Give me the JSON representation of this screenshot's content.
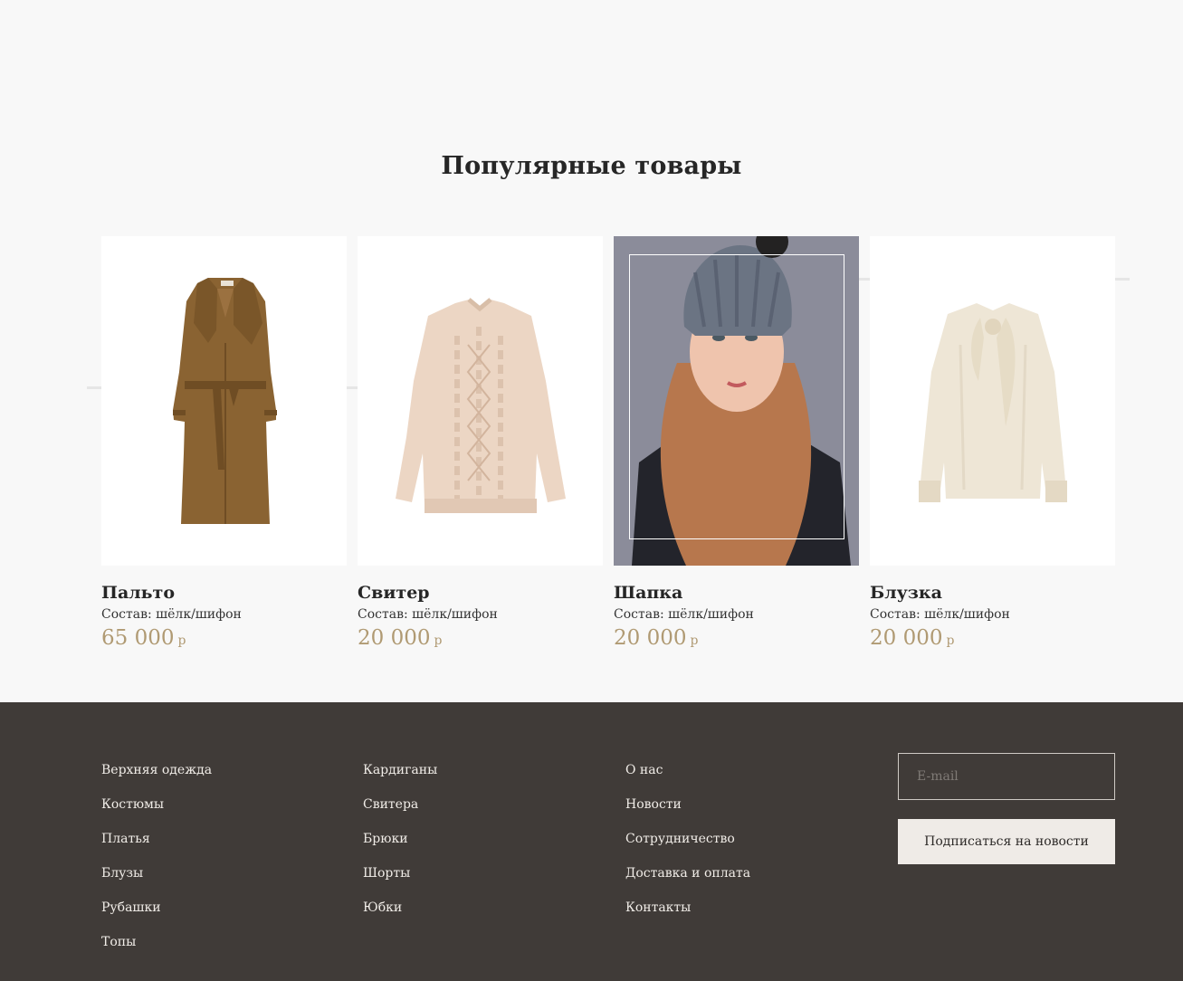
{
  "section": {
    "title": "Популярные товары"
  },
  "products": [
    {
      "name": "Пальто",
      "composition": "Состав: шёлк/шифон",
      "price": "65 000",
      "currency": "р",
      "image": "coat-image"
    },
    {
      "name": "Свитер",
      "composition": "Состав: шёлк/шифон",
      "price": "20 000",
      "currency": "р",
      "image": "sweater-image"
    },
    {
      "name": "Шапка",
      "composition": "Состав: шёлк/шифон",
      "price": "20 000",
      "currency": "р",
      "image": "hat-model-image"
    },
    {
      "name": "Блузка",
      "composition": "Состав: шёлк/шифон",
      "price": "20 000",
      "currency": "р",
      "image": "blouse-image"
    }
  ],
  "footer": {
    "col1": [
      "Верхняя одежда",
      "Костюмы",
      "Платья",
      "Блузы",
      "Рубашки",
      "Топы"
    ],
    "col2": [
      "Кардиганы",
      "Свитера",
      "Брюки",
      "Шорты",
      "Юбки"
    ],
    "col3": [
      "О нас",
      "Новости",
      "Сотрудничество",
      "Доставка и оплата",
      "Контакты"
    ],
    "email_placeholder": "E-mail",
    "subscribe_label": "Подписаться на новости"
  },
  "colors": {
    "price": "#b09a73",
    "footer_bg": "#403b38",
    "page_bg": "#f8f8f8"
  }
}
